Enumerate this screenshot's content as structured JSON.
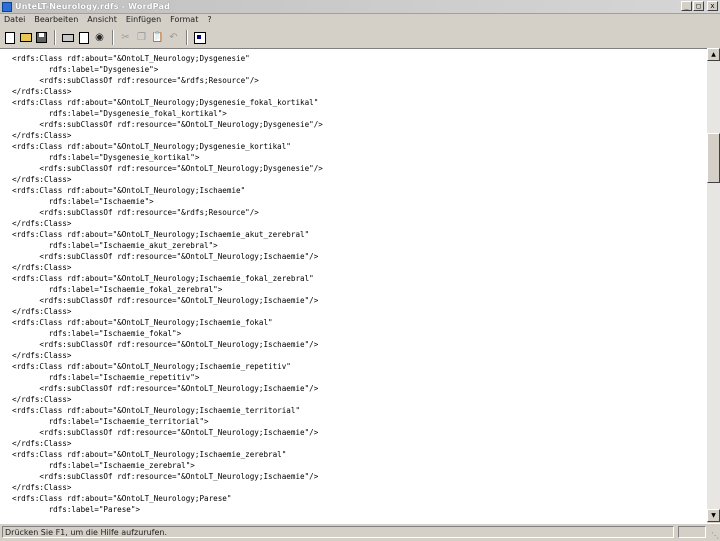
{
  "window": {
    "title": "UnteLT-Neurology.rdfs - WordPad",
    "buttons": {
      "minimize": "_",
      "maximize": "□",
      "close": "x"
    }
  },
  "menu": [
    "Datei",
    "Bearbeiten",
    "Ansicht",
    "Einfügen",
    "Format",
    "?"
  ],
  "toolbar": {
    "icons": [
      "new-icon",
      "open-icon",
      "save-icon",
      "print-icon",
      "print-preview-icon",
      "find-icon",
      "cut-icon",
      "copy-icon",
      "paste-icon",
      "undo-icon",
      "date-time-icon"
    ]
  },
  "document": {
    "lines": [
      "<rdfs:Class rdf:about=\"&OntoLT_Neurology;Dysgenesie\"",
      "        rdfs:label=\"Dysgenesie\">",
      "      <rdfs:subClassOf rdf:resource=\"&rdfs;Resource\"/>",
      "</rdfs:Class>",
      "<rdfs:Class rdf:about=\"&OntoLT_Neurology;Dysgenesie_fokal_kortikal\"",
      "        rdfs:label=\"Dysgenesie_fokal_kortikal\">",
      "      <rdfs:subClassOf rdf:resource=\"&OntoLT_Neurology;Dysgenesie\"/>",
      "</rdfs:Class>",
      "<rdfs:Class rdf:about=\"&OntoLT_Neurology;Dysgenesie_kortikal\"",
      "        rdfs:label=\"Dysgenesie_kortikal\">",
      "      <rdfs:subClassOf rdf:resource=\"&OntoLT_Neurology;Dysgenesie\"/>",
      "</rdfs:Class>",
      "<rdfs:Class rdf:about=\"&OntoLT_Neurology;Ischaemie\"",
      "        rdfs:label=\"Ischaemie\">",
      "      <rdfs:subClassOf rdf:resource=\"&rdfs;Resource\"/>",
      "</rdfs:Class>",
      "<rdfs:Class rdf:about=\"&OntoLT_Neurology;Ischaemie_akut_zerebral\"",
      "        rdfs:label=\"Ischaemie_akut_zerebral\">",
      "      <rdfs:subClassOf rdf:resource=\"&OntoLT_Neurology;Ischaemie\"/>",
      "</rdfs:Class>",
      "<rdfs:Class rdf:about=\"&OntoLT_Neurology;Ischaemie_fokal_zerebral\"",
      "        rdfs:label=\"Ischaemie_fokal_zerebral\">",
      "      <rdfs:subClassOf rdf:resource=\"&OntoLT_Neurology;Ischaemie\"/>",
      "</rdfs:Class>",
      "<rdfs:Class rdf:about=\"&OntoLT_Neurology;Ischaemie_fokal\"",
      "        rdfs:label=\"Ischaemie_fokal\">",
      "      <rdfs:subClassOf rdf:resource=\"&OntoLT_Neurology;Ischaemie\"/>",
      "</rdfs:Class>",
      "<rdfs:Class rdf:about=\"&OntoLT_Neurology;Ischaemie_repetitiv\"",
      "        rdfs:label=\"Ischaemie_repetitiv\">",
      "      <rdfs:subClassOf rdf:resource=\"&OntoLT_Neurology;Ischaemie\"/>",
      "</rdfs:Class>",
      "<rdfs:Class rdf:about=\"&OntoLT_Neurology;Ischaemie_territorial\"",
      "        rdfs:label=\"Ischaemie_territorial\">",
      "      <rdfs:subClassOf rdf:resource=\"&OntoLT_Neurology;Ischaemie\"/>",
      "</rdfs:Class>",
      "<rdfs:Class rdf:about=\"&OntoLT_Neurology;Ischaemie_zerebral\"",
      "        rdfs:label=\"Ischaemie_zerebral\">",
      "      <rdfs:subClassOf rdf:resource=\"&OntoLT_Neurology;Ischaemie\"/>",
      "</rdfs:Class>",
      "<rdfs:Class rdf:about=\"&OntoLT_Neurology;Parese\"",
      "        rdfs:label=\"Parese\">"
    ]
  },
  "scrollbar": {
    "up_arrow": "▲",
    "down_arrow": "▼"
  },
  "statusbar": {
    "text": "Drücken Sie F1, um die Hilfe aufzurufen."
  }
}
